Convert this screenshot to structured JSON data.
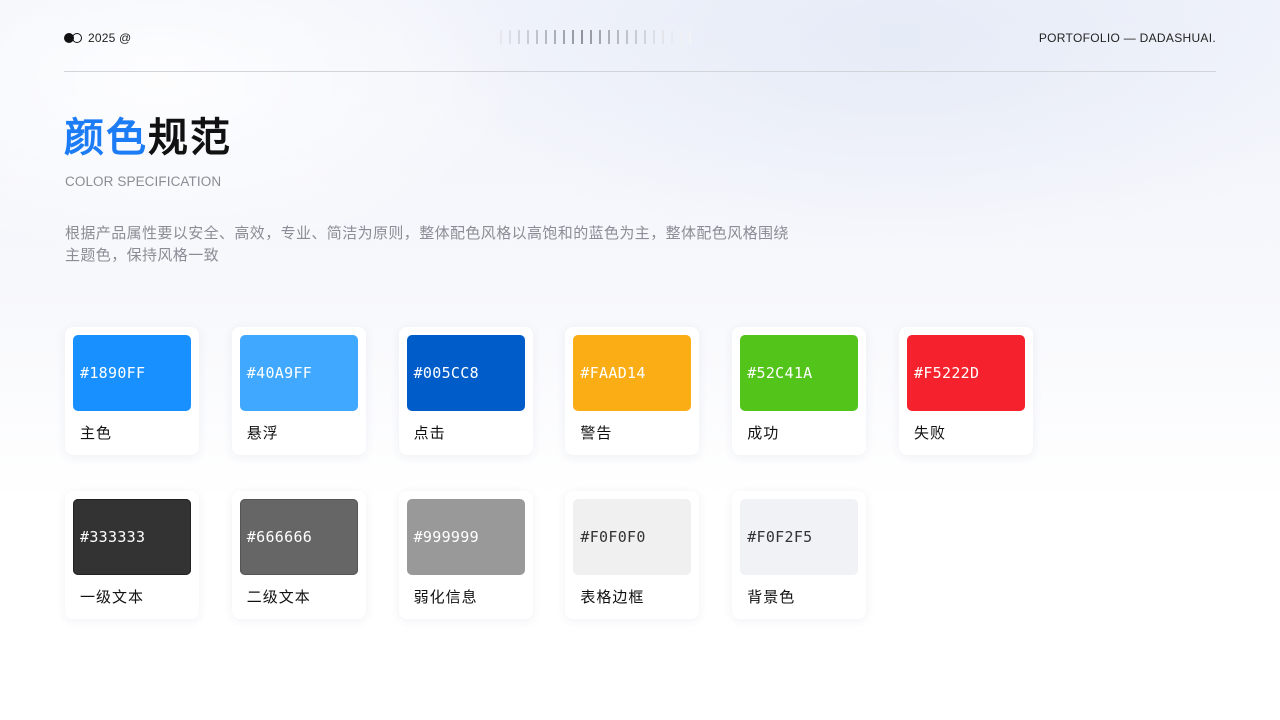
{
  "header": {
    "year": "2025 @",
    "portfolio": "PORTOFOLIO —  DADASHUAI."
  },
  "title": {
    "highlight": "颜色",
    "rest": "规范"
  },
  "subtitle": "COLOR SPECIFICATION",
  "description": "根据产品属性要以安全、高效，专业、简洁为原则，整体配色风格以高饱和的蓝色为主，整体配色风格围绕主题色，保持风格一致",
  "colors_row1": [
    {
      "hex": "#1890FF",
      "name": "主色",
      "color": "#1890FF",
      "text": "#ffffff"
    },
    {
      "hex": "#40A9FF",
      "name": "悬浮",
      "color": "#40A9FF",
      "text": "#ffffff"
    },
    {
      "hex": "#005CC8",
      "name": "点击",
      "color": "#005CC8",
      "text": "#ffffff"
    },
    {
      "hex": "#FAAD14",
      "name": "警告",
      "color": "#FAAD14",
      "text": "#ffffff"
    },
    {
      "hex": "#52C41A",
      "name": "成功",
      "color": "#52C41A",
      "text": "#ffffff"
    },
    {
      "hex": "#F5222D",
      "name": "失败",
      "color": "#F5222D",
      "text": "#ffffff"
    }
  ],
  "colors_row2": [
    {
      "hex": "#333333",
      "name": "一级文本",
      "color": "#333333",
      "text": "#ffffff"
    },
    {
      "hex": "#666666",
      "name": "二级文本",
      "color": "#666666",
      "text": "#ffffff"
    },
    {
      "hex": "#999999",
      "name": "弱化信息",
      "color": "#999999",
      "text": "#ffffff"
    },
    {
      "hex": "#F0F0F0",
      "name": "表格边框",
      "color": "#F0F0F0",
      "text": "#333333"
    },
    {
      "hex": "#F0F2F5",
      "name": "背景色",
      "color": "#F0F2F5",
      "text": "#333333"
    }
  ]
}
